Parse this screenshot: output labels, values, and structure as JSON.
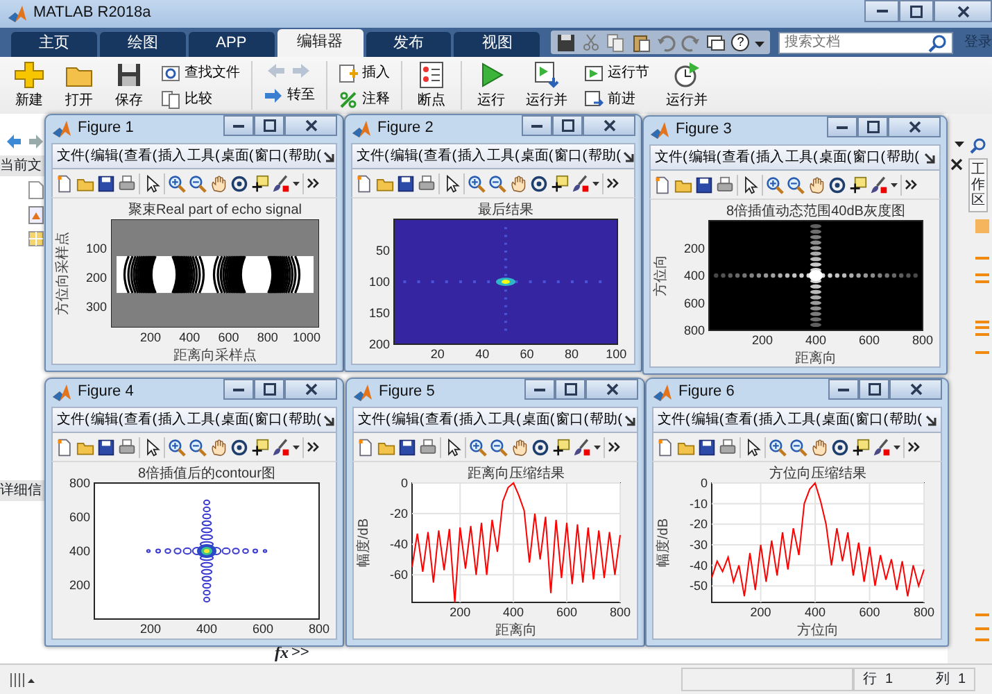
{
  "window": {
    "title": "MATLAB R2018a"
  },
  "tabs": [
    {
      "label": "主页",
      "selected": false
    },
    {
      "label": "绘图",
      "selected": false
    },
    {
      "label": "APP",
      "selected": false
    },
    {
      "label": "编辑器",
      "selected": true
    },
    {
      "label": "发布",
      "selected": false
    },
    {
      "label": "视图",
      "selected": false
    }
  ],
  "quick_access": {
    "help": "?"
  },
  "search": {
    "placeholder": "搜索文档"
  },
  "sign_in": "登录",
  "toolstrip": [
    {
      "kind": "large",
      "label": "新建"
    },
    {
      "kind": "large",
      "label": "打开"
    },
    {
      "kind": "large",
      "label": "保存"
    },
    {
      "kind": "stack",
      "items": [
        "查找文件",
        "比较"
      ]
    },
    {
      "kind": "nav",
      "items": [
        "转至"
      ]
    },
    {
      "kind": "stack",
      "items": [
        "插入",
        "注释"
      ]
    },
    {
      "kind": "large",
      "label": "断点"
    },
    {
      "kind": "large",
      "label": "运行"
    },
    {
      "kind": "large",
      "label": "运行并"
    },
    {
      "kind": "stack",
      "items": [
        "运行节",
        "前进"
      ]
    },
    {
      "kind": "large",
      "label": "运行并"
    }
  ],
  "left_panel": {
    "header": "当前文",
    "details": "详细信"
  },
  "right_panel": {
    "tab": "工作区"
  },
  "command": {
    "fx": "fx",
    "prompt": ">>"
  },
  "figures": [
    {
      "title": "Figure 1",
      "menu": [
        "文件(",
        "编辑(",
        "查看(",
        "插入",
        "工具(",
        "桌面(",
        "窗口(",
        "帮助("
      ],
      "plot": {
        "kind": "echo",
        "title": "聚束Real part of echo signal",
        "xlabel": "距离向采样点",
        "ylabel": "方位向采样点",
        "xticks": [
          "200",
          "400",
          "600",
          "800",
          "1000"
        ],
        "yticks": [
          "100",
          "200",
          "300"
        ]
      }
    },
    {
      "title": "Figure 2",
      "menu": [
        "文件(",
        "编辑(",
        "查看(",
        "插入",
        "工具(",
        "桌面(",
        "窗口(",
        "帮助("
      ],
      "plot": {
        "kind": "spectrum",
        "title": "最后结果",
        "xticks": [
          "20",
          "40",
          "60",
          "80",
          "100"
        ],
        "yticks": [
          "50",
          "100",
          "150",
          "200"
        ]
      }
    },
    {
      "title": "Figure 3",
      "menu": [
        "文件(",
        "编辑(",
        "查看(",
        "插入",
        "工具(",
        "桌面(",
        "窗口(",
        "帮助("
      ],
      "plot": {
        "kind": "gray",
        "title": "8倍插值动态范围40dB灰度图",
        "xlabel": "距离向",
        "ylabel": "方位向",
        "xticks": [
          "200",
          "400",
          "600",
          "800"
        ],
        "yticks": [
          "200",
          "400",
          "600",
          "800"
        ]
      }
    },
    {
      "title": "Figure 4",
      "menu": [
        "文件(",
        "编辑(",
        "查看(",
        "插入",
        "工具(",
        "桌面(",
        "窗口(",
        "帮助("
      ],
      "plot": {
        "kind": "contour",
        "title": "8倍插值后的contour图",
        "xticks": [
          "200",
          "400",
          "600",
          "800"
        ],
        "yticks": [
          "800",
          "600",
          "400",
          "200"
        ]
      }
    },
    {
      "title": "Figure 5",
      "menu": [
        "文件(",
        "编辑(",
        "查看(",
        "插入",
        "工具(",
        "桌面(",
        "窗口(",
        "帮助("
      ],
      "chart_data": {
        "type": "line",
        "title": "距离向压缩结果",
        "xlabel": "距离向",
        "ylabel": "幅度/dB",
        "x": [
          20,
          40,
          60,
          80,
          100,
          120,
          140,
          160,
          180,
          200,
          220,
          240,
          260,
          280,
          300,
          320,
          340,
          360,
          380,
          400,
          420,
          440,
          460,
          480,
          500,
          520,
          540,
          560,
          580,
          600,
          620,
          640,
          660,
          680,
          700,
          720,
          740,
          760,
          780,
          800
        ],
        "series": [
          {
            "color": "#ff0000",
            "values": [
              -55,
              -33,
              -58,
              -32,
              -65,
              -31,
              -57,
              -30,
              -78,
              -29,
              -56,
              -28,
              -60,
              -26,
              -60,
              -24,
              -45,
              -12,
              -3,
              0,
              -8,
              -18,
              -52,
              -20,
              -50,
              -22,
              -72,
              -24,
              -62,
              -26,
              -66,
              -27,
              -65,
              -29,
              -63,
              -31,
              -62,
              -32,
              -60,
              -34
            ]
          }
        ],
        "grid": true,
        "xlim": [
          20,
          800
        ],
        "ylim": [
          -78,
          0
        ],
        "xticks": [
          200,
          400,
          600,
          800
        ],
        "yticks": [
          -60,
          -40,
          -20,
          0
        ]
      }
    },
    {
      "title": "Figure 6",
      "menu": [
        "文件(",
        "编辑(",
        "查看(",
        "插入",
        "工具(",
        "桌面(",
        "窗口(",
        "帮助("
      ],
      "chart_data": {
        "type": "line",
        "title": "方位向压缩结果",
        "xlabel": "方位向",
        "ylabel": "幅度/dB",
        "x": [
          20,
          40,
          60,
          80,
          100,
          120,
          140,
          160,
          180,
          200,
          220,
          240,
          260,
          280,
          300,
          320,
          340,
          360,
          380,
          400,
          420,
          440,
          460,
          480,
          500,
          520,
          540,
          560,
          580,
          600,
          620,
          640,
          660,
          680,
          700,
          720,
          740,
          760,
          780,
          800
        ],
        "series": [
          {
            "color": "#ff0000",
            "values": [
              -46,
              -38,
              -43,
              -36,
              -48,
              -40,
              -55,
              -34,
              -52,
              -30,
              -48,
              -28,
              -45,
              -24,
              -42,
              -22,
              -35,
              -10,
              -3,
              0,
              -9,
              -20,
              -40,
              -22,
              -38,
              -24,
              -45,
              -29,
              -48,
              -31,
              -50,
              -35,
              -47,
              -37,
              -52,
              -38,
              -55,
              -40,
              -50,
              -42
            ]
          }
        ],
        "grid": true,
        "xlim": [
          20,
          800
        ],
        "ylim": [
          -58,
          0
        ],
        "xticks": [
          200,
          400,
          600,
          800
        ],
        "yticks": [
          -50,
          -40,
          -30,
          -20,
          -10,
          0
        ]
      }
    }
  ],
  "status_bar": {
    "row_label": "行",
    "row": "1",
    "col_label": "列",
    "col": "1"
  }
}
